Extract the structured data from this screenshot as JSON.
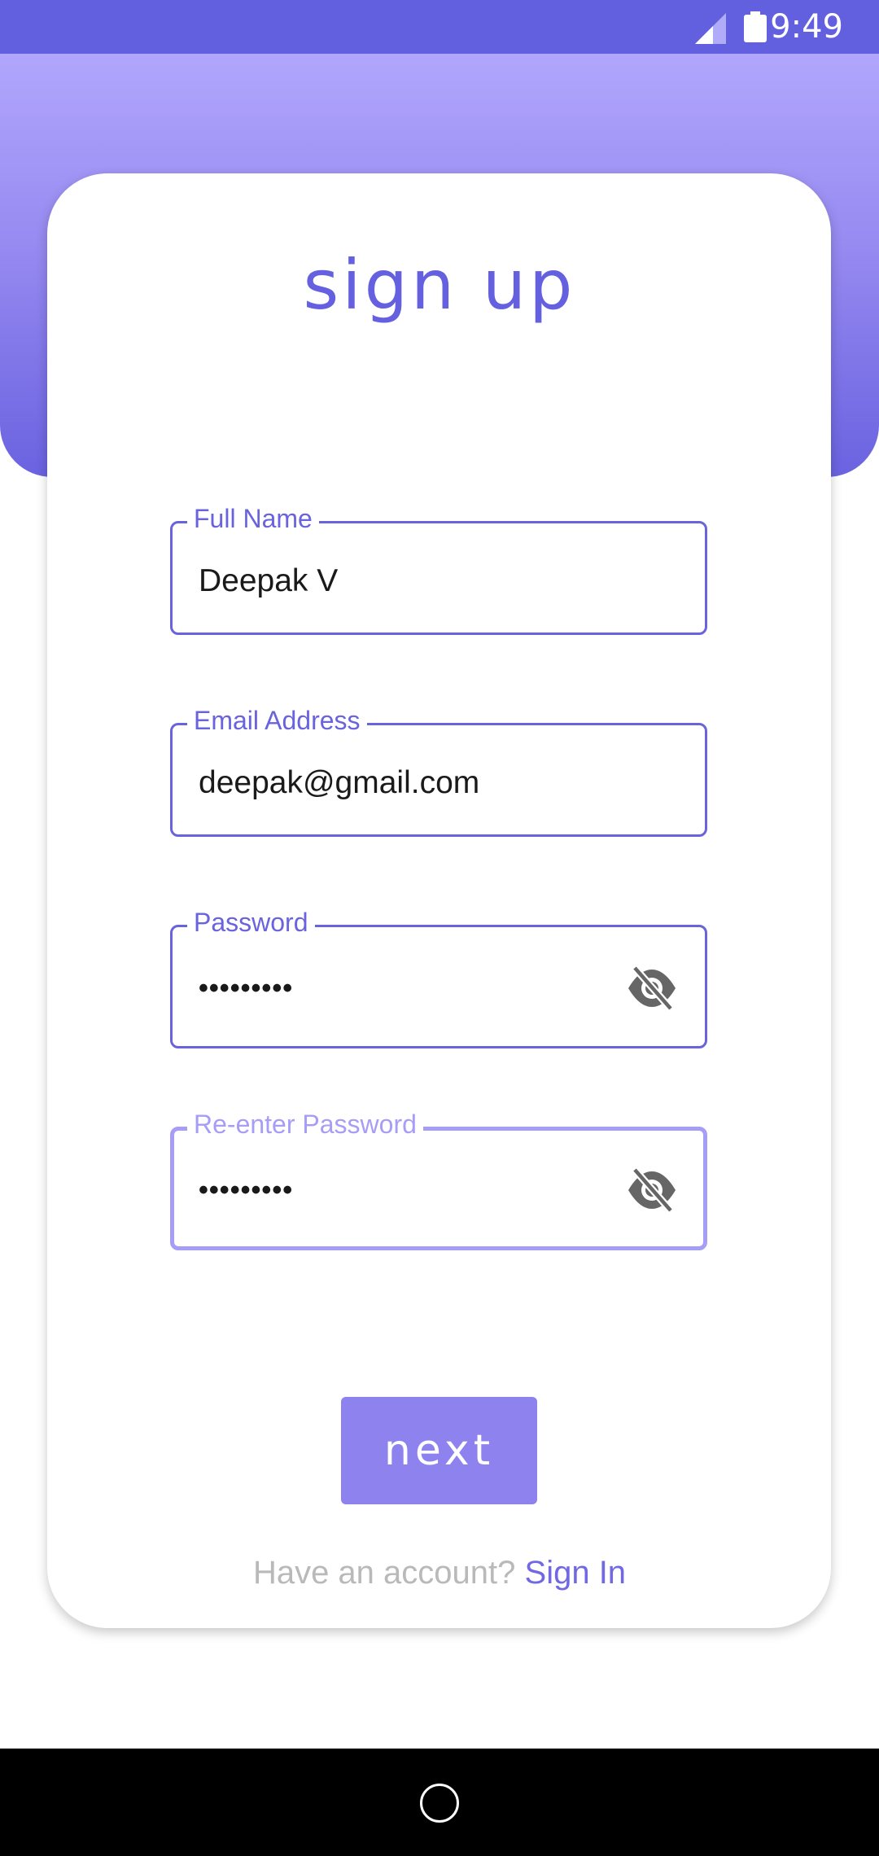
{
  "status_bar": {
    "time": "9:49"
  },
  "title": "sign up",
  "fields": [
    {
      "label": "Full Name",
      "value": "Deepak V"
    },
    {
      "label": "Email Address",
      "value": "deepak@gmail.com"
    },
    {
      "label": "Password",
      "value": "•••••••••"
    },
    {
      "label": "Re-enter Password",
      "value": "•••••••••"
    }
  ],
  "next_button": "next",
  "account_prompt": "Have an account?",
  "signin_link": "Sign In",
  "icons": {
    "status": [
      "signal-icon",
      "battery-icon"
    ],
    "field": "eye-off-icon",
    "nav": "home-icon"
  },
  "colors": {
    "primary": "#6a63de",
    "focused_border": "#a69ef6",
    "button": "#8e82ef",
    "header_top": "#b1a6fd",
    "header_bottom": "#6a62e0"
  }
}
